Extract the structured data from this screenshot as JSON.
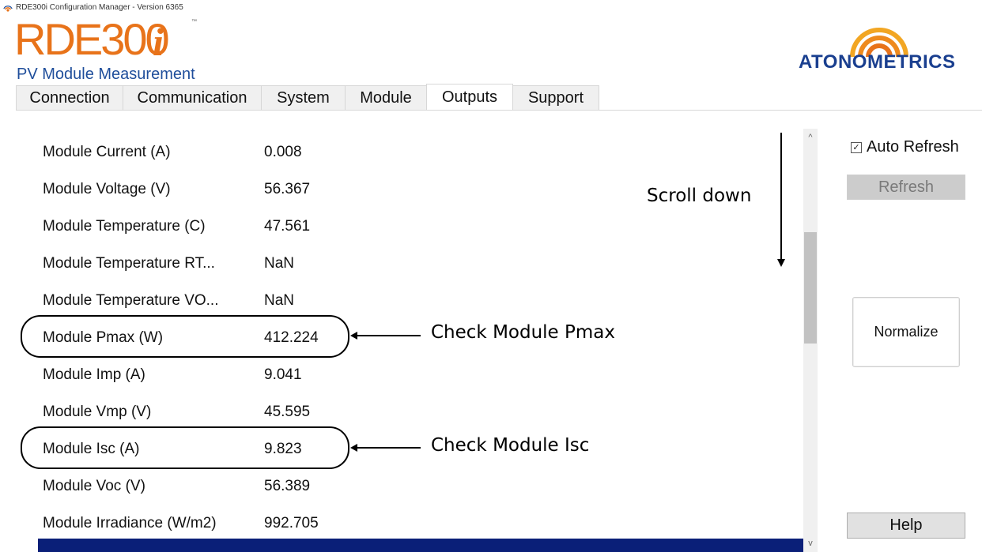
{
  "window": {
    "title": "RDE300i Configuration Manager - Version 6365",
    "icon": "app-signal-icon"
  },
  "product_logo": {
    "main": "RDE300",
    "i": "i",
    "tm": "™",
    "subtitle": "PV Module Measurement"
  },
  "company_logo": {
    "name": "ATONOMETRICS"
  },
  "tabs": [
    {
      "label": "Connection",
      "active": false
    },
    {
      "label": "Communication",
      "active": false
    },
    {
      "label": "System",
      "active": false
    },
    {
      "label": "Module",
      "active": false
    },
    {
      "label": "Outputs",
      "active": true
    },
    {
      "label": "Support",
      "active": false
    }
  ],
  "outputs": [
    {
      "label": "Module Current (A)",
      "value": "0.008"
    },
    {
      "label": "Module Voltage (V)",
      "value": "56.367"
    },
    {
      "label": "Module Temperature (C)",
      "value": "47.561"
    },
    {
      "label": "Module Temperature RT...",
      "value": "NaN"
    },
    {
      "label": "Module Temperature VO...",
      "value": "NaN"
    },
    {
      "label": "Module Pmax (W)",
      "value": "412.224"
    },
    {
      "label": "Module Imp (A)",
      "value": "9.041"
    },
    {
      "label": "Module Vmp (V)",
      "value": "45.595"
    },
    {
      "label": "Module Isc (A)",
      "value": "9.823"
    },
    {
      "label": "Module Voc (V)",
      "value": "56.389"
    },
    {
      "label": "Module Irradiance (W/m2)",
      "value": "992.705"
    }
  ],
  "scrollbar": {
    "up_glyph": "^",
    "down_glyph": "v"
  },
  "right_panel": {
    "auto_refresh_label": "Auto Refresh",
    "auto_refresh_checked": true,
    "auto_refresh_check_glyph": "✓",
    "refresh_label": "Refresh",
    "normalize_label": "Normalize",
    "help_label": "Help"
  },
  "annotations": {
    "scroll_down": "Scroll down",
    "check_pmax": "Check Module Pmax",
    "check_isc": "Check Module Isc"
  },
  "colors": {
    "logo_orange": "#e8731a",
    "logo_blue": "#1f4e9b",
    "company_blue": "#1a3f8f",
    "selection_navy": "#0a1f78"
  }
}
